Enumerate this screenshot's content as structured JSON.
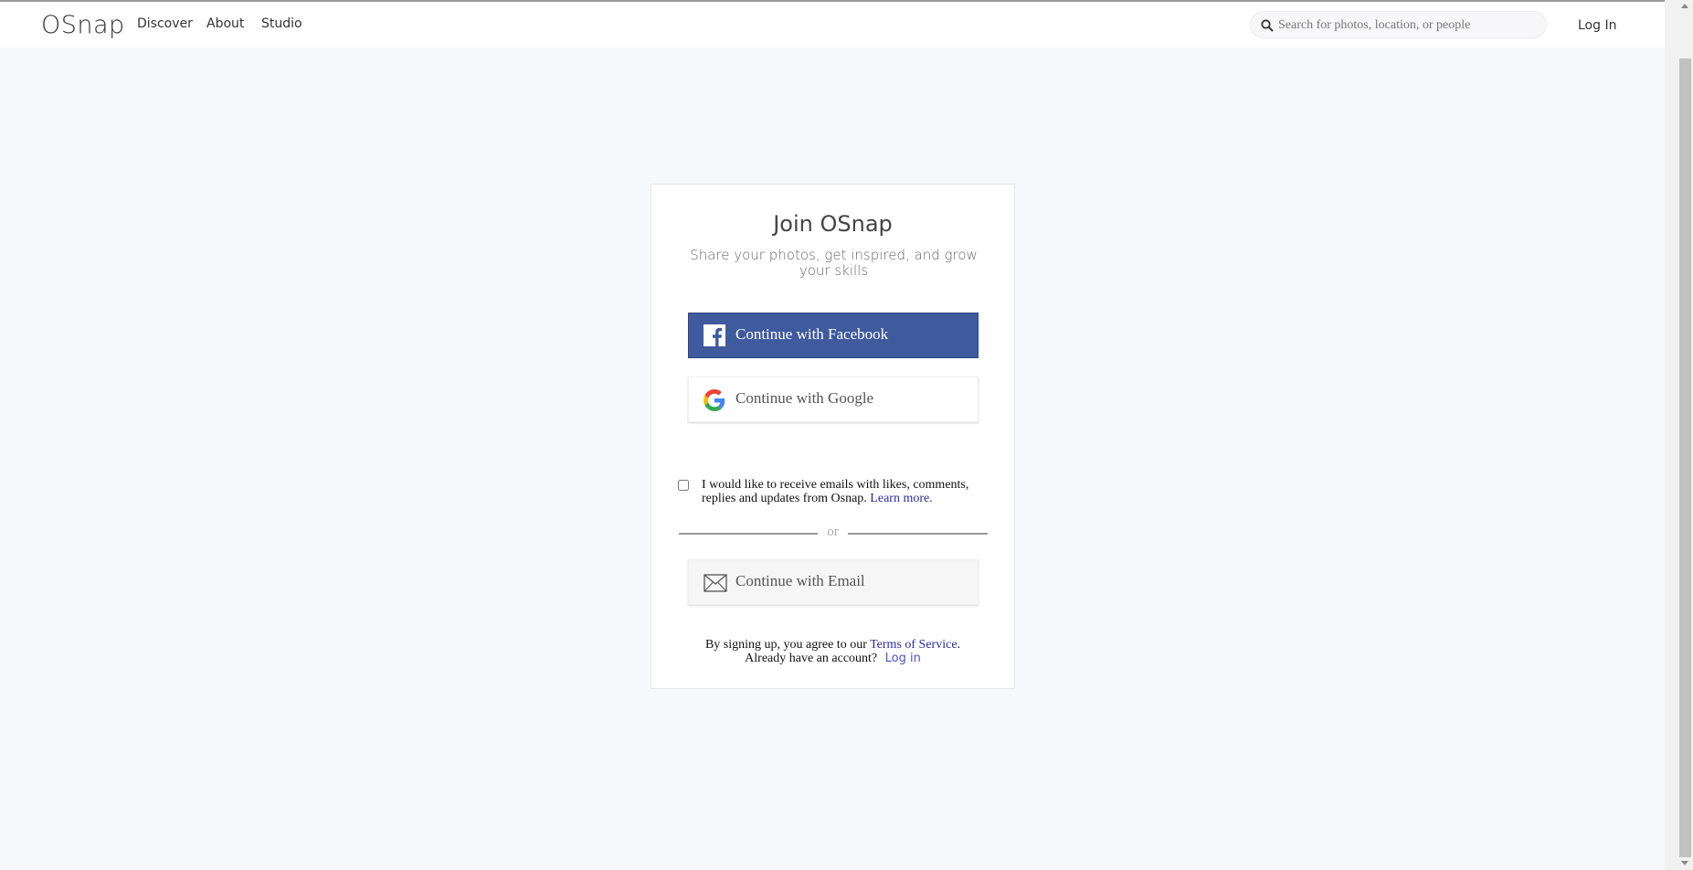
{
  "header": {
    "logo": "OSnap",
    "nav": [
      "Discover",
      "About",
      "Studio"
    ],
    "search_placeholder": "Search for photos, location, or people",
    "login_label": "Log In"
  },
  "signup": {
    "title": "Join OSnap",
    "subtitle": "Share your photos, get inspired, and grow your skills",
    "facebook_label": "Continue with Facebook",
    "google_label": "Continue with Google",
    "consent_text": "I would like to receive emails with likes, comments, replies and updates from Osnap.",
    "consent_link": "Learn more.",
    "divider": "or",
    "email_label": "Continue with Email",
    "terms_prefix": "By signing up, you agree to our",
    "terms_link": "Terms of Service",
    "terms_suffix": ".",
    "account_prompt": "Already have an account?",
    "login_link": "Log in"
  },
  "colors": {
    "facebook": "#3f5b9e",
    "link": "#2a2b9e",
    "background": "#f7f8fc"
  },
  "icons": [
    "search-icon",
    "facebook-icon",
    "google-icon",
    "mail-icon"
  ]
}
